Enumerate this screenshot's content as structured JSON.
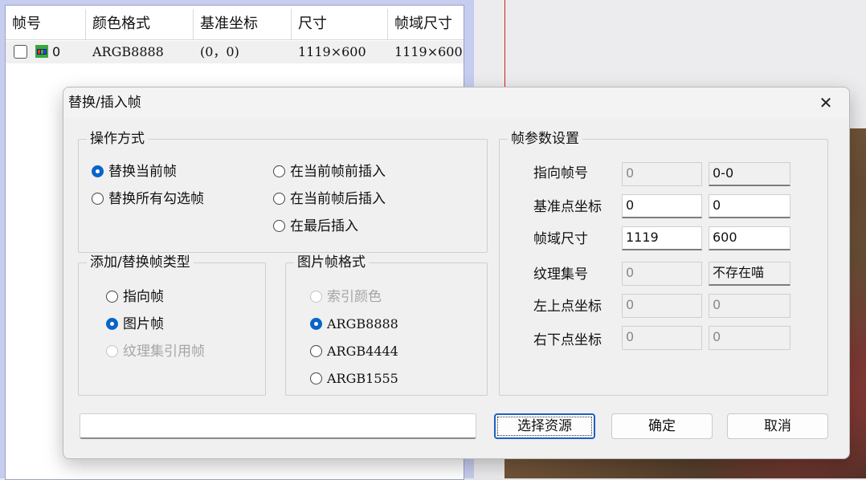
{
  "background": {
    "table": {
      "columns": [
        "帧号",
        "颜色格式",
        "基准坐标",
        "尺寸",
        "帧域尺寸"
      ],
      "rows": [
        {
          "frame": "0",
          "color_format": "ARGB8888",
          "base_coord": "(0，0)",
          "size": "1119×600",
          "frame_size": "1119×600"
        }
      ]
    }
  },
  "dialog": {
    "title": "替换/插入帧",
    "close_glyph": "✕",
    "operation": {
      "title": "操作方式",
      "options": [
        {
          "label": "替换当前帧",
          "selected": true,
          "disabled": false
        },
        {
          "label": "在当前帧前插入",
          "selected": false,
          "disabled": false
        },
        {
          "label": "替换所有勾选帧",
          "selected": false,
          "disabled": false
        },
        {
          "label": "在当前帧后插入",
          "selected": false,
          "disabled": false
        },
        {
          "label": "在最后插入",
          "selected": false,
          "disabled": false
        }
      ]
    },
    "frame_type": {
      "title": "添加/替换帧类型",
      "options": [
        {
          "label": "指向帧",
          "selected": false,
          "disabled": false
        },
        {
          "label": "图片帧",
          "selected": true,
          "disabled": false
        },
        {
          "label": "纹理集引用帧",
          "selected": false,
          "disabled": true
        }
      ]
    },
    "image_format": {
      "title": "图片帧格式",
      "options": [
        {
          "label": "索引颜色",
          "selected": false,
          "disabled": true
        },
        {
          "label": "ARGB8888",
          "selected": true,
          "disabled": false
        },
        {
          "label": "ARGB4444",
          "selected": false,
          "disabled": false
        },
        {
          "label": "ARGB1555",
          "selected": false,
          "disabled": false
        }
      ]
    },
    "params": {
      "title": "帧参数设置",
      "rows": [
        {
          "label": "指向帧号",
          "v1": "0",
          "v2": "0-0"
        },
        {
          "label": "基准点坐标",
          "v1": "0",
          "v2": "0"
        },
        {
          "label": "帧域尺寸",
          "v1": "1119",
          "v2": "600"
        },
        {
          "label": "纹理集号",
          "v1": "0",
          "v2": "不存在喵"
        },
        {
          "label": "左上点坐标",
          "v1": "0",
          "v2": "0"
        },
        {
          "label": "右下点坐标",
          "v1": "0",
          "v2": "0"
        }
      ]
    },
    "path_value": "",
    "buttons": {
      "select": "选择资源",
      "ok": "确定",
      "cancel": "取消"
    }
  }
}
